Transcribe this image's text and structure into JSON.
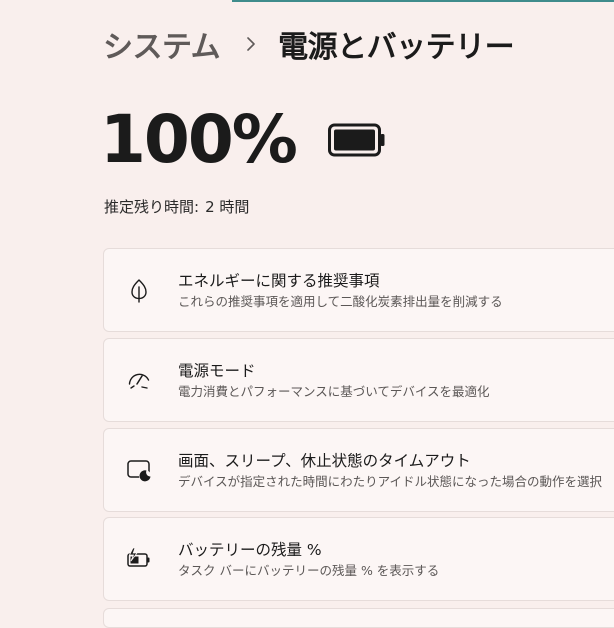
{
  "breadcrumb": {
    "parent": "システム",
    "current": "電源とバッテリー"
  },
  "battery": {
    "percent_text": "100%",
    "percent_value": 100,
    "estimate_label": "推定残り時間:",
    "estimate_value": "2 時間"
  },
  "cards": [
    {
      "title": "エネルギーに関する推奨事項",
      "subtitle": "これらの推奨事項を適用して二酸化炭素排出量を削減する",
      "icon": "leaf-icon"
    },
    {
      "title": "電源モード",
      "subtitle": "電力消費とパフォーマンスに基づいてデバイスを最適化",
      "icon": "gauge-icon"
    },
    {
      "title": "画面、スリープ、休止状態のタイムアウト",
      "subtitle": "デバイスが指定された時間にわたりアイドル状態になった場合の動作を選択",
      "icon": "screen-sleep-icon"
    },
    {
      "title": "バッテリーの残量 %",
      "subtitle": "タスク バーにバッテリーの残量 % を表示する",
      "icon": "battery-charging-icon"
    }
  ],
  "colors": {
    "background": "#f9efed",
    "card": "#fcf6f5",
    "accent": "#3f8c8c"
  }
}
